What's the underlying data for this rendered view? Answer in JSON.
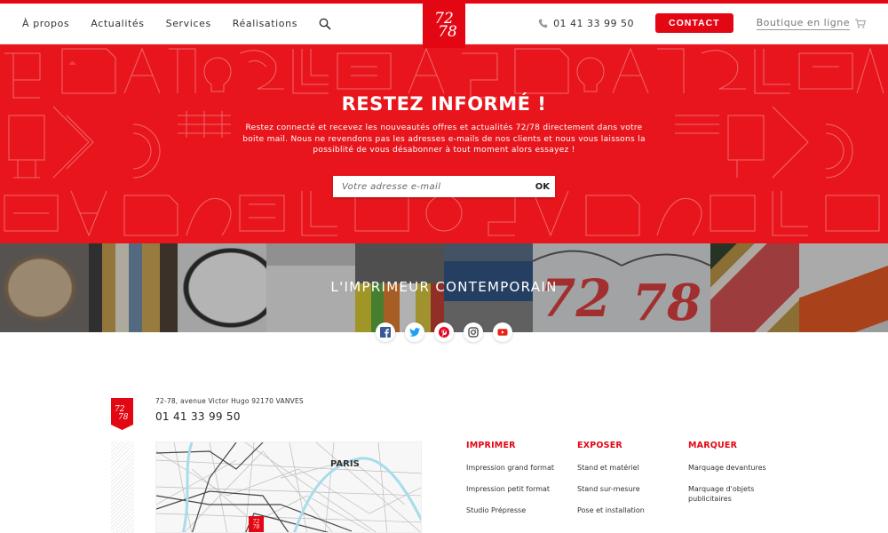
{
  "header": {
    "nav": [
      "À propos",
      "Actualités",
      "Services",
      "Réalisations"
    ],
    "logo_top": "72",
    "logo_bottom": "78",
    "phone": "01 41 33 99 50",
    "contact_label": "CONTACT",
    "shop_label": "Boutique en ligne"
  },
  "newsletter": {
    "title": "RESTEZ INFORMÉ !",
    "text": "Restez connecté et recevez les nouveautés offres et actualités 72/78 directement dans votre boite mail. Nous ne revendons pas les adresses e-mails de nos clients et nous vous laissons la possiblité de vous désabonner à tout moment alors essayez !",
    "email_placeholder": "Votre adresse e-mail",
    "submit_label": "OK"
  },
  "band": {
    "title": "L'IMPRIMEUR CONTEMPORAIN",
    "socials": [
      "facebook",
      "twitter",
      "pinterest",
      "instagram",
      "youtube"
    ]
  },
  "footer": {
    "address": "72-78, avenue Victor Hugo 92170 VANVES",
    "phone": "01 41 33 99 50",
    "map_label": "PARIS",
    "pin_top": "72",
    "pin_bottom": "78",
    "columns": [
      {
        "title": "IMPRIMER",
        "links": [
          "Impression grand format",
          "Impression petit format",
          "Studio Prépresse"
        ]
      },
      {
        "title": "EXPOSER",
        "links": [
          "Stand et matériel",
          "Stand sur-mesure",
          "Pose et installation"
        ]
      },
      {
        "title": "MARQUER",
        "links": [
          "Marquage devantures",
          "Marquage d'objets publicitaires"
        ]
      }
    ]
  },
  "colors": {
    "brand_red": "#e30613"
  }
}
